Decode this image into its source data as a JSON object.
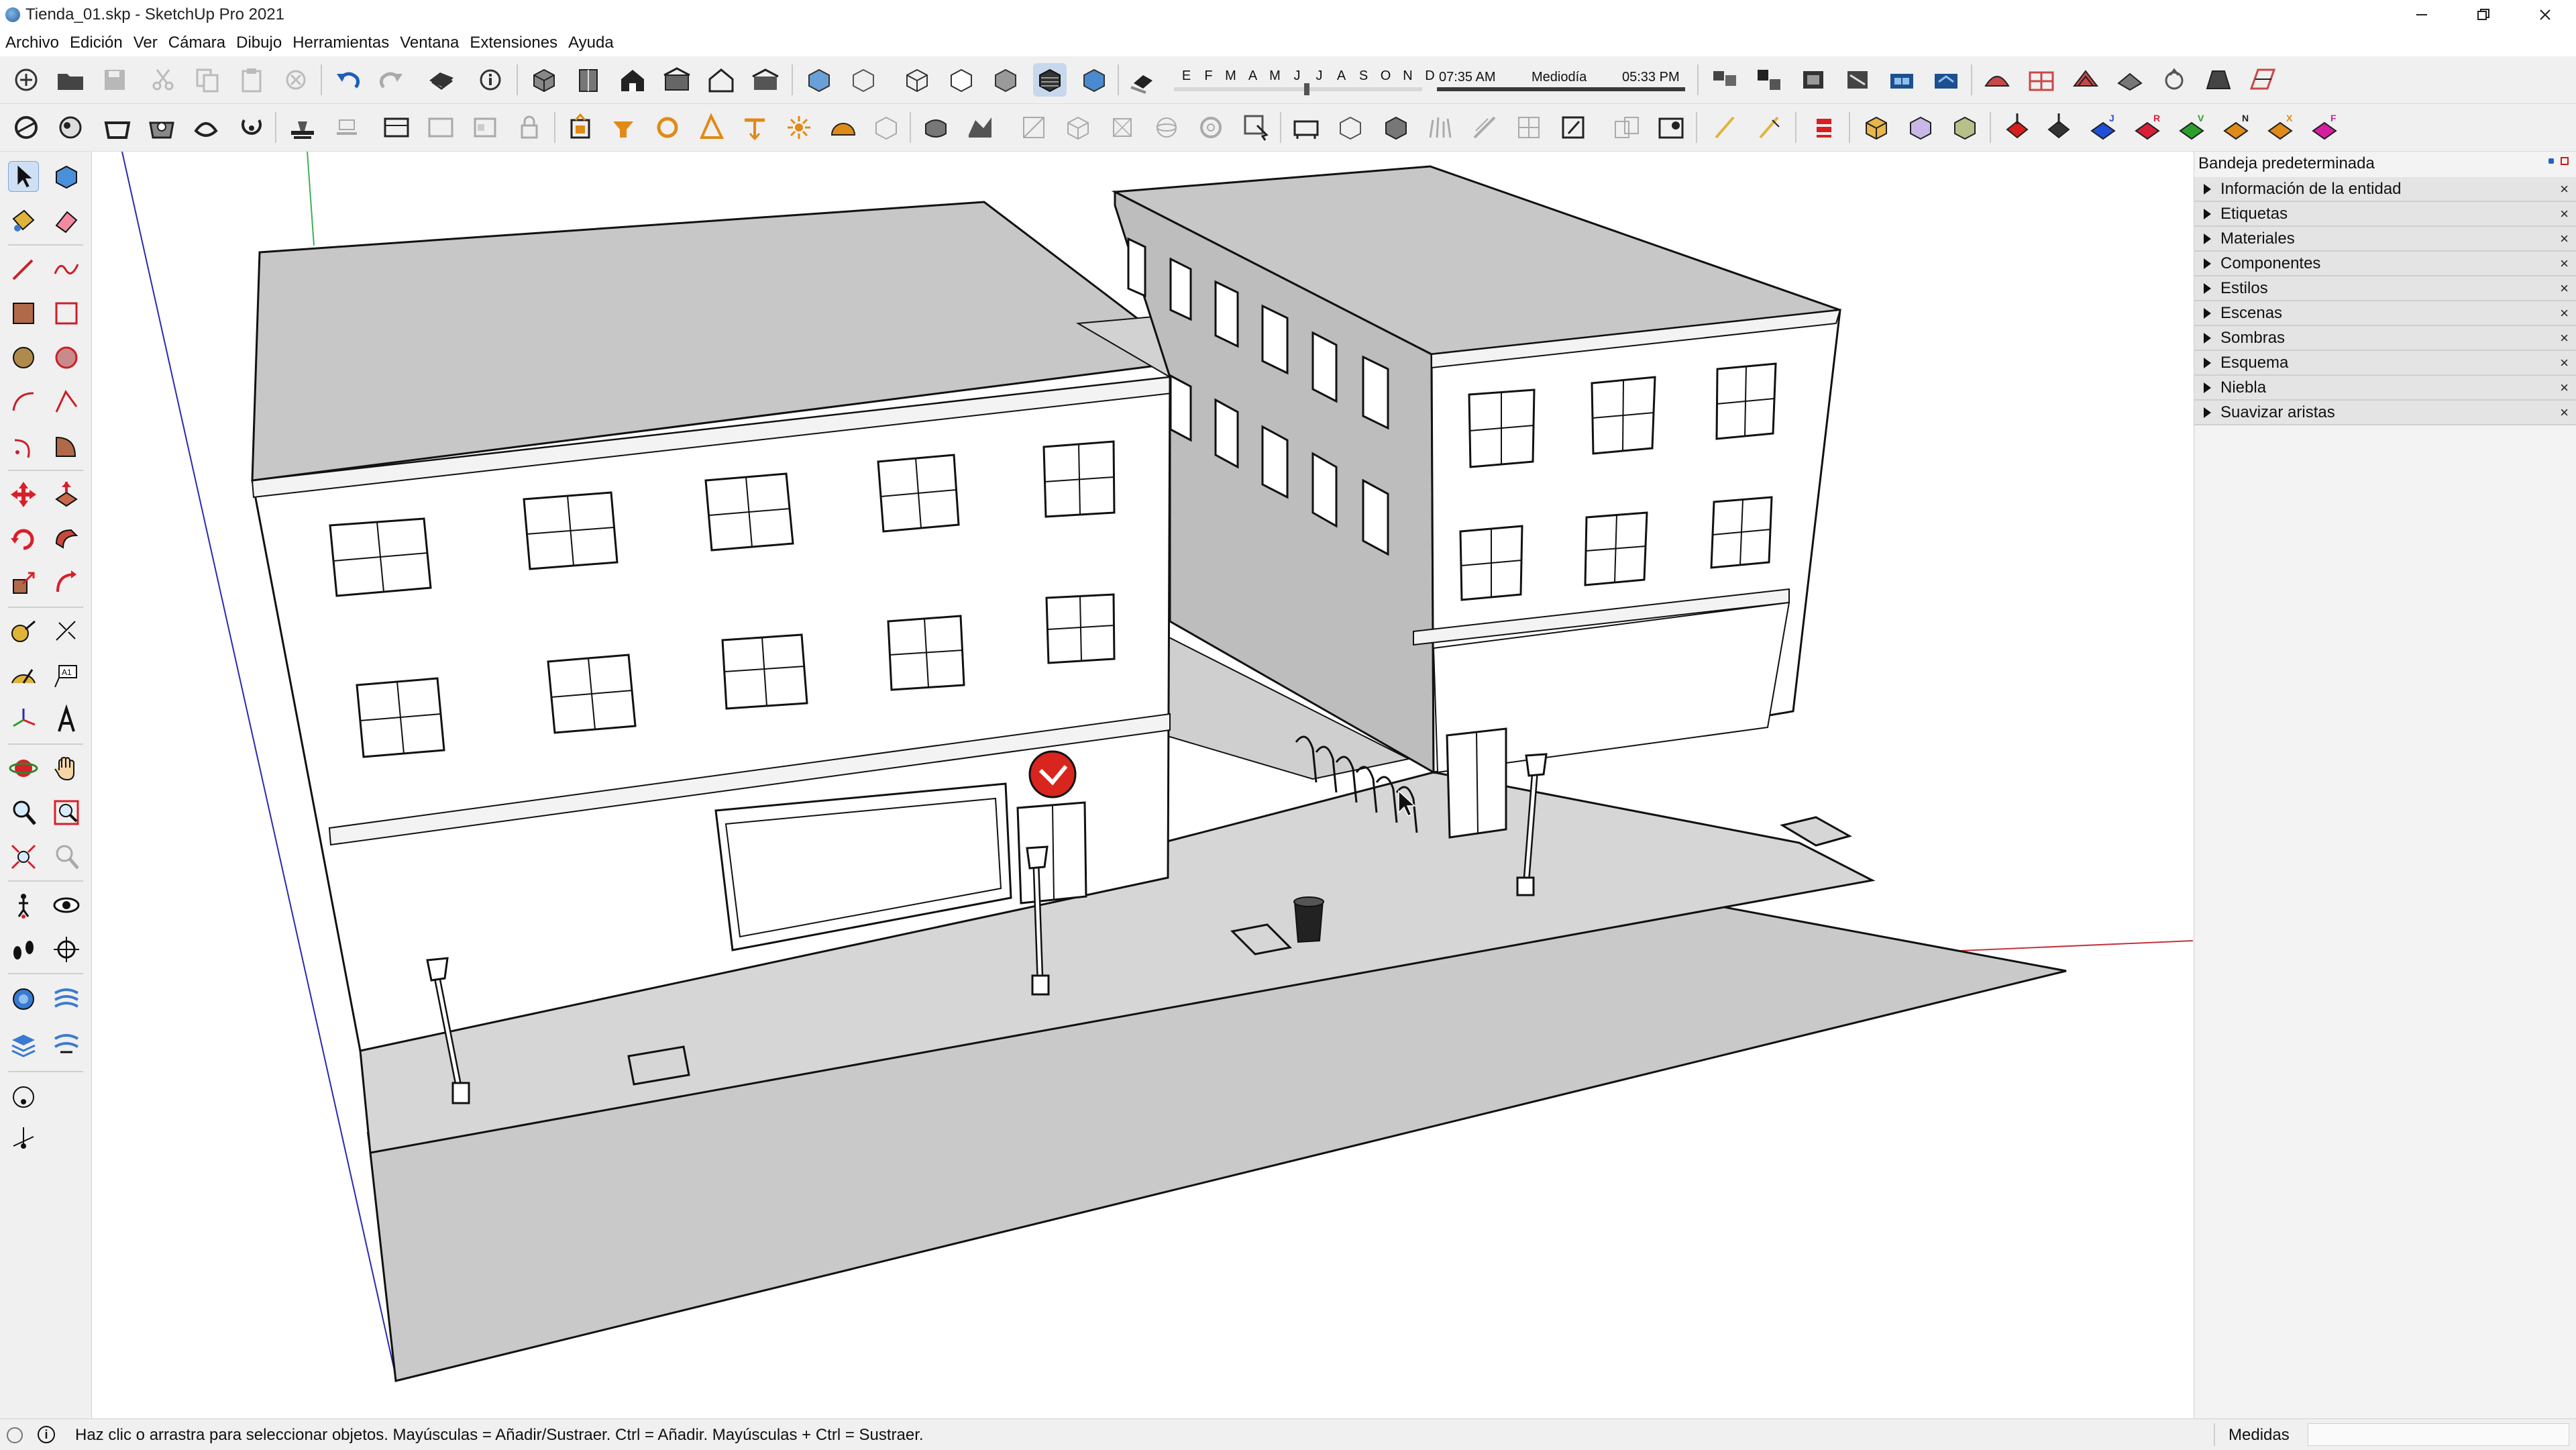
{
  "window": {
    "title": "Tienda_01.skp - SketchUp Pro 2021",
    "controls": [
      "minimize",
      "restore",
      "close"
    ]
  },
  "menu": [
    "Archivo",
    "Edición",
    "Ver",
    "Cámara",
    "Dibujo",
    "Herramientas",
    "Ventana",
    "Extensiones",
    "Ayuda"
  ],
  "shadow_settings": {
    "months": [
      "E",
      "F",
      "M",
      "A",
      "M",
      "J",
      "J",
      "A",
      "S",
      "O",
      "N",
      "D"
    ],
    "time_start": "07:35 AM",
    "time_mid": "Mediodía",
    "time_end": "05:33 PM"
  },
  "axis_tools": [
    {
      "letter": "J",
      "color": "#1e4fd8"
    },
    {
      "letter": "R",
      "color": "#d81e3a"
    },
    {
      "letter": "V",
      "color": "#2aa02a"
    },
    {
      "letter": "N",
      "color": "#222222"
    },
    {
      "letter": "X",
      "color": "#e08a18"
    },
    {
      "letter": "F",
      "color": "#d81ea0"
    }
  ],
  "tray": {
    "title": "Bandeja predeterminada",
    "panels": [
      "Información de la entidad",
      "Etiquetas",
      "Materiales",
      "Componentes",
      "Estilos",
      "Escenas",
      "Sombras",
      "Esquema",
      "Niebla",
      "Suavizar aristas"
    ],
    "close_glyph": "×"
  },
  "status": {
    "hint": "Haz clic o arrastra para seleccionar objetos. Mayúsculas = Añadir/Sustraer. Ctrl = Añadir. Mayúsculas + Ctrl = Sustraer.",
    "measurements_label": "Medidas",
    "measurements_value": ""
  },
  "colors": {
    "axis_red": "#c8323c",
    "axis_green": "#3fb05a",
    "axis_blue": "#2a2ab0",
    "roof_gray": "#c7c7c7",
    "facade_white": "#ffffff",
    "shade_gray": "#bdbdbd",
    "ground_gray": "#c9c9c9",
    "accent_red": "#d8251d"
  }
}
